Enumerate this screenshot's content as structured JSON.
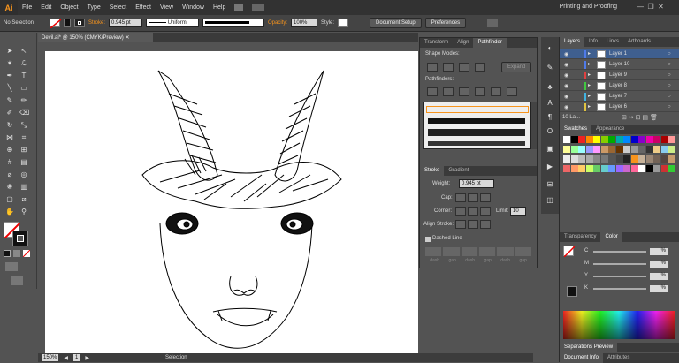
{
  "app": {
    "logo": "Ai",
    "workspace": "Printing and Proofing"
  },
  "menu": [
    "File",
    "Edit",
    "Object",
    "Type",
    "Select",
    "Effect",
    "View",
    "Window",
    "Help"
  ],
  "control": {
    "selection": "No Selection",
    "stroke_label": "Stroke:",
    "stroke_value": "0.945 pt",
    "profile": "Uniform",
    "opacity_label": "Opacity:",
    "opacity_value": "100%",
    "style_label": "Style:",
    "doc_setup": "Document Setup",
    "preferences": "Preferences"
  },
  "document": {
    "tab": "Devil.ai* @ 150% (CMYK/Preview)"
  },
  "status": {
    "zoom": "150%",
    "page": "1",
    "mode": "Selection"
  },
  "floatpanel": {
    "tabs": [
      "Transform",
      "Align",
      "Pathfinder"
    ],
    "shape_modes": "Shape Modes:",
    "expand": "Expand",
    "pathfinders": "Pathfinders:",
    "stroke_tabs": [
      "Stroke",
      "Gradient"
    ],
    "weight_label": "Weight:",
    "weight_value": "0.945 pt",
    "cap_label": "Cap:",
    "corner_label": "Corner:",
    "limit_label": "Limit:",
    "limit_value": "10",
    "align_label": "Align Stroke:",
    "dashed_label": "Dashed Line",
    "dash_labels": [
      "dash",
      "gap",
      "dash",
      "gap",
      "dash",
      "gap"
    ]
  },
  "layers": {
    "tabs": [
      "Layers",
      "Info",
      "Links",
      "Artboards"
    ],
    "items": [
      {
        "name": "Layer 1",
        "color": "#4f7ae8"
      },
      {
        "name": "Layer 10",
        "color": "#4f7ae8"
      },
      {
        "name": "Layer 9",
        "color": "#e04141"
      },
      {
        "name": "Layer 8",
        "color": "#41c741"
      },
      {
        "name": "Layer 7",
        "color": "#41b3e0"
      },
      {
        "name": "Layer 6",
        "color": "#e0c341"
      }
    ],
    "count": "10 La..."
  },
  "swatches": {
    "tabs": [
      "Swatches",
      "Appearance"
    ]
  },
  "color": {
    "tabs": [
      "Transparency",
      "Color"
    ],
    "channels": [
      {
        "label": "C",
        "value": "%"
      },
      {
        "label": "M",
        "value": "%"
      },
      {
        "label": "Y",
        "value": "%"
      },
      {
        "label": "K",
        "value": "%"
      }
    ]
  },
  "bottom_panels": {
    "separations": "Separations Preview",
    "doc_info": "Document Info",
    "attributes": "Attributes"
  }
}
